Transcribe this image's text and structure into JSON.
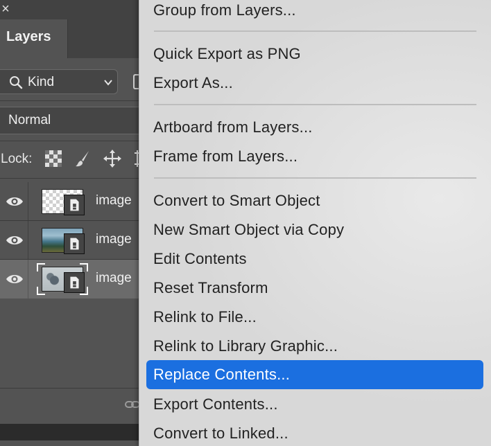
{
  "layers_panel": {
    "tab_title": "Layers",
    "kind_filter": {
      "label": "Kind"
    },
    "blend_mode": "Normal",
    "lock_label": "Lock:",
    "layers": [
      {
        "name": "image",
        "thumbnail": "transparent",
        "selected": false
      },
      {
        "name": "image",
        "thumbnail": "coast-photo",
        "selected": false
      },
      {
        "name": "image",
        "thumbnail": "misty-photo",
        "selected": true
      }
    ]
  },
  "context_menu": {
    "groups": [
      [
        "Group from Layers..."
      ],
      [
        "Quick Export as PNG",
        "Export As..."
      ],
      [
        "Artboard from Layers...",
        "Frame from Layers..."
      ],
      [
        "Convert to Smart Object",
        "New Smart Object via Copy",
        "Edit Contents",
        "Reset Transform",
        "Relink to File...",
        "Relink to Library Graphic...",
        "Replace Contents...",
        "Export Contents...",
        "Convert to Linked..."
      ]
    ],
    "highlighted_item": "Replace Contents...",
    "highlight_color": "#1b6fe0"
  },
  "icons": [
    "close-icon",
    "search-icon",
    "chevron-down-icon",
    "lock-transparent-pixels-icon",
    "lock-image-pixels-icon",
    "lock-position-icon",
    "lock-artboard-icon",
    "eye-icon",
    "smart-object-badge-icon",
    "link-icon"
  ]
}
